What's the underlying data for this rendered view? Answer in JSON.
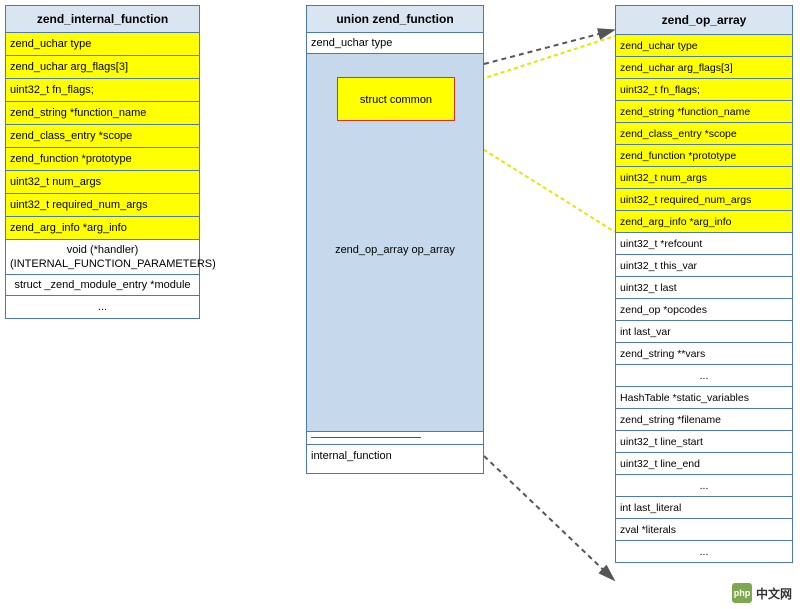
{
  "colors": {
    "border": "#4a7ab0",
    "header_bg": "#d9e5f1",
    "highlight": "#ffff00",
    "union_bg": "#c6d9ec",
    "common_border": "#e03030"
  },
  "left": {
    "title": "zend_internal_function",
    "rows": [
      {
        "text": "zend_uchar type",
        "hl": true
      },
      {
        "text": "zend_uchar arg_flags[3]",
        "hl": true
      },
      {
        "text": "uint32_t fn_flags;",
        "hl": true
      },
      {
        "text": "zend_string *function_name",
        "hl": true
      },
      {
        "text": "zend_class_entry *scope",
        "hl": true
      },
      {
        "text": "zend_function *prototype",
        "hl": true
      },
      {
        "text": "uint32_t num_args",
        "hl": true
      },
      {
        "text": "uint32_t required_num_args",
        "hl": true
      },
      {
        "text": "zend_arg_info *arg_info",
        "hl": true
      },
      {
        "text": "void (*handler)(INTERNAL_FUNCTION_PARAMETERS)",
        "hl": false,
        "center": true,
        "multi": true
      },
      {
        "text": "struct _zend_module_entry *module",
        "hl": false,
        "center": true,
        "multi": true
      },
      {
        "text": "...",
        "hl": false,
        "center": true
      }
    ]
  },
  "middle": {
    "title": "union zend_function",
    "top_row": "zend_uchar type",
    "common_label": "struct common",
    "op_array_label": "zend_op_array op_array",
    "strike_text": "———————————",
    "bottom_row": "internal_function"
  },
  "right": {
    "title": "zend_op_array",
    "rows": [
      {
        "text": "zend_uchar type",
        "hl": true
      },
      {
        "text": "zend_uchar arg_flags[3]",
        "hl": true
      },
      {
        "text": "uint32_t fn_flags;",
        "hl": true
      },
      {
        "text": "zend_string *function_name",
        "hl": true
      },
      {
        "text": "zend_class_entry *scope",
        "hl": true
      },
      {
        "text": "zend_function *prototype",
        "hl": true
      },
      {
        "text": "uint32_t num_args",
        "hl": true
      },
      {
        "text": "uint32_t required_num_args",
        "hl": true
      },
      {
        "text": "zend_arg_info *arg_info",
        "hl": true
      },
      {
        "text": "uint32_t *refcount",
        "hl": false
      },
      {
        "text": "uint32_t this_var",
        "hl": false
      },
      {
        "text": "uint32_t last",
        "hl": false
      },
      {
        "text": "zend_op *opcodes",
        "hl": false
      },
      {
        "text": "int last_var",
        "hl": false
      },
      {
        "text": "zend_string **vars",
        "hl": false
      },
      {
        "text": "...",
        "hl": false,
        "center": true
      },
      {
        "text": "HashTable *static_variables",
        "hl": false
      },
      {
        "text": "zend_string *filename",
        "hl": false
      },
      {
        "text": "uint32_t line_start",
        "hl": false
      },
      {
        "text": "uint32_t line_end",
        "hl": false
      },
      {
        "text": "...",
        "hl": false,
        "center": true
      },
      {
        "text": "int last_literal",
        "hl": false
      },
      {
        "text": "zval *literals",
        "hl": false
      },
      {
        "text": "...",
        "hl": false,
        "center": true
      }
    ]
  },
  "watermark": {
    "logo": "php",
    "text": "中文网"
  }
}
